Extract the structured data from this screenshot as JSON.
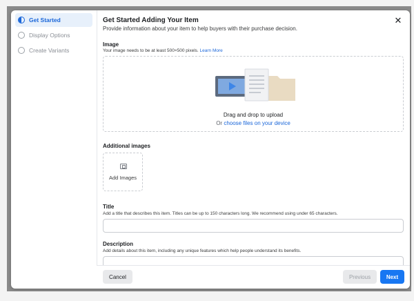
{
  "sidebar": {
    "steps": [
      {
        "label": "Get Started",
        "active": true
      },
      {
        "label": "Display Options",
        "active": false
      },
      {
        "label": "Create Variants",
        "active": false
      }
    ]
  },
  "header": {
    "title": "Get Started Adding Your Item",
    "subtitle": "Provide information about your item to help buyers with their purchase decision.",
    "close_icon": "close-icon"
  },
  "image_section": {
    "label": "Image",
    "help": "Your image needs to be at least 500×500 pixels.",
    "learn_more": "Learn More",
    "drop_text": "Drag and drop to upload",
    "or_text": "Or",
    "choose_link": "choose files on your device"
  },
  "additional_images": {
    "label": "Additional images",
    "add_label": "Add Images",
    "icon": "image-icon"
  },
  "title_field": {
    "label": "Title",
    "help": "Add a title that describes this item. Titles can be up to 150 characters long. We recommend using under 65 characters.",
    "value": ""
  },
  "description_field": {
    "label": "Description",
    "help": "Add details about this item, including any unique features which help people understand its benefits.",
    "value": ""
  },
  "footer": {
    "cancel": "Cancel",
    "previous": "Previous",
    "next": "Next"
  },
  "colors": {
    "accent": "#1877f2",
    "active_step_bg": "#e7f0fb"
  }
}
